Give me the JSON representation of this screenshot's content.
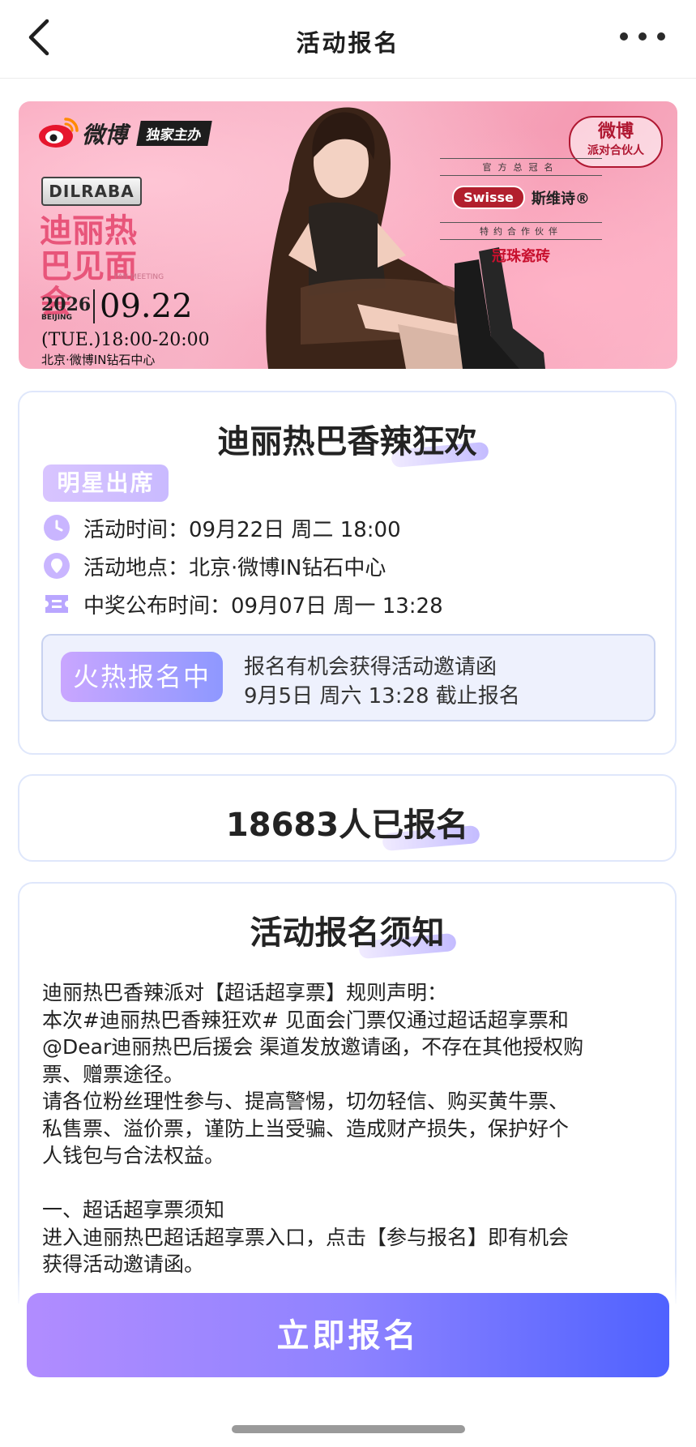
{
  "header": {
    "title": "活动报名"
  },
  "banner": {
    "weibo_text": "微博",
    "exclusive_tag": "独家主办",
    "artist_badge": "DILRABA",
    "event_title": "迪丽热巴见面会",
    "fan_meeting": "FAN MEETING",
    "year": "2026",
    "city": "BEIJING",
    "date": "09.22",
    "time": "(TUE.)18:00-20:00",
    "venue": "北京·微博IN钻石中心",
    "sponsor_label": "官方总冠名",
    "sponsor_logo": "Swisse",
    "sponsor_cn": "斯维诗®",
    "partner_label": "特约合作伙伴",
    "partner_name": "冠珠瓷砖",
    "party_badge_line1": "微博",
    "party_badge_line2": "派对合伙人"
  },
  "info": {
    "title": "迪丽热巴香辣狂欢",
    "tag": "明星出席",
    "time": "活动时间：09月22日 周二 18:00",
    "location": "活动地点：北京·微博IN钻石中心",
    "announce": "中奖公布时间：09月07日 周一 13:28",
    "status_badge": "火热报名中",
    "status_line1": "报名有机会获得活动邀请函",
    "status_line2": "9月5日 周六 13:28 截止报名"
  },
  "count": {
    "text": "18683人已报名"
  },
  "notice": {
    "title": "活动报名须知",
    "body": "迪丽热巴香辣派对【超话超享票】规则声明：\n本次#迪丽热巴香辣狂欢# 见面会门票仅通过超话超享票和\n@Dear迪丽热巴后援会 渠道发放邀请函，不存在其他授权购\n票、赠票途径。\n请各位粉丝理性参与、提高警惕，切勿轻信、购买黄牛票、\n私售票、溢价票，谨防上当受骗、造成财产损失，保护好个\n人钱包与合法权益。\n\n一、超话超享票须知\n进入迪丽热巴超话超享票入口，点击【参与报名】即有机会\n获得活动邀请函。"
  },
  "cta": {
    "label": "立即报名"
  },
  "colors": {
    "accent_start": "#b18cff",
    "accent_end": "#4f62ff",
    "banner_pink": "#f7b3c6"
  }
}
